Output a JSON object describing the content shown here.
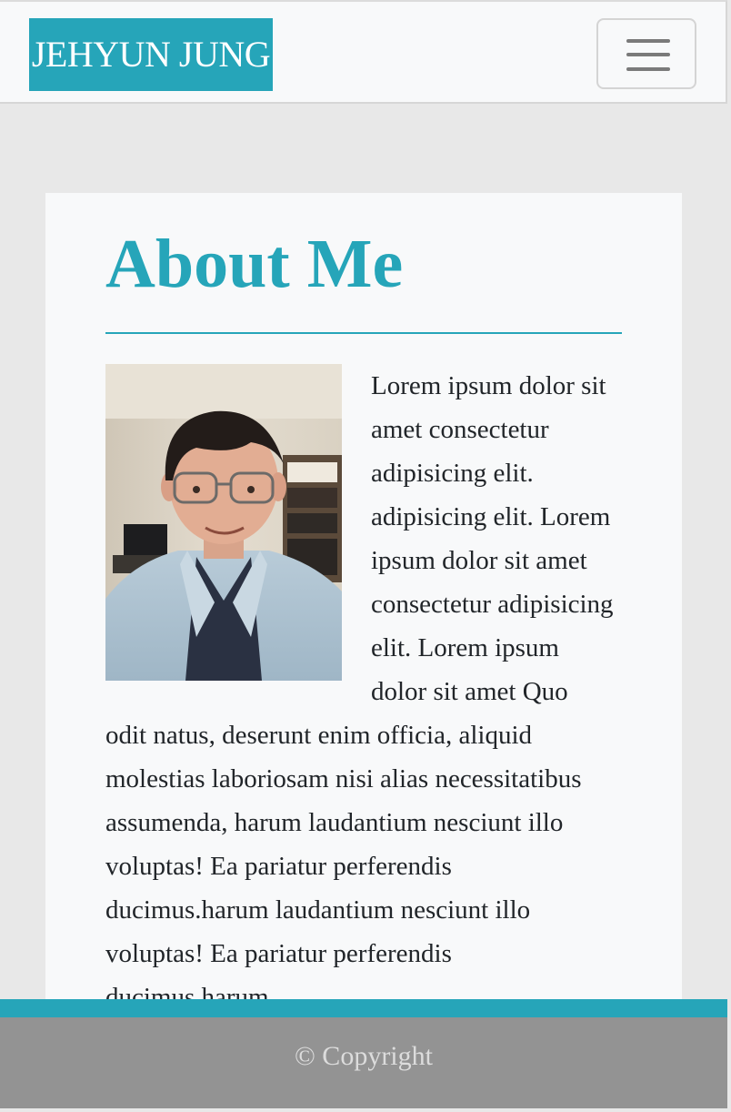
{
  "navbar": {
    "brand": "JEHYUN JUNG",
    "toggle_icon": "hamburger-menu-icon"
  },
  "about": {
    "title": "About Me",
    "photo_alt": "Portrait photo of Jehyun Jung",
    "paragraph": "Lorem ipsum dolor sit amet consectetur adipisicing elit. adipisicing elit. Lorem ipsum dolor sit amet consectetur adipisicing elit. Lorem ipsum dolor sit amet Quo odit natus, deserunt enim officia, aliquid molestias laboriosam nisi alias necessitatibus assumenda, harum laudantium nesciunt illo voluptas! Ea pariatur perferendis ducimus.harum laudantium nesciunt illo voluptas! Ea pariatur perferendis ducimus.harum"
  },
  "footer": {
    "text": "© Copyright"
  },
  "colors": {
    "accent": "#26a5b9",
    "footer_bg": "#939393",
    "page_bg": "#e8e8e8",
    "card_bg": "#f8f9fa"
  }
}
